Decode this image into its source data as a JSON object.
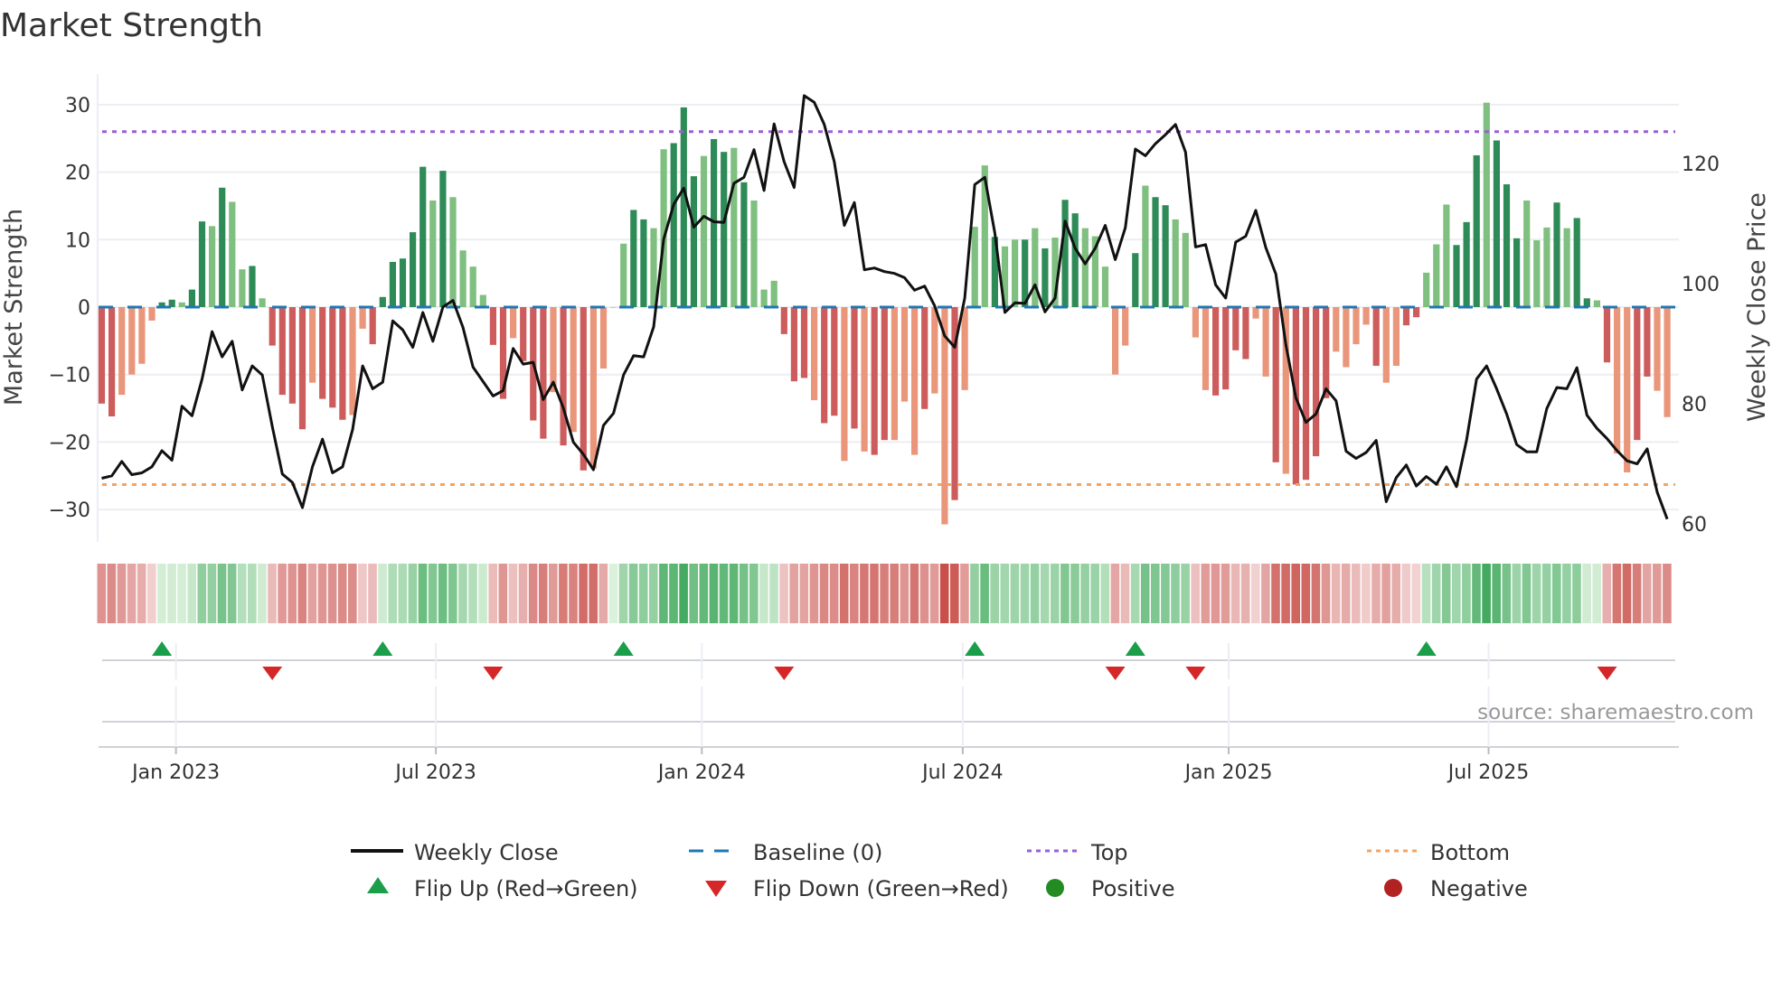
{
  "chart_data": {
    "type": "bar",
    "title": "Market Strength",
    "ylabel": "Market Strength",
    "y2label": "Weekly Close Price",
    "ylim": [
      -35,
      35
    ],
    "y2lim": [
      58,
      136
    ],
    "yticks": [
      "30",
      "20",
      "10",
      "0",
      "−10",
      "−20",
      "−30"
    ],
    "ytick_values": [
      30,
      20,
      10,
      0,
      -10,
      -20,
      -30
    ],
    "y2ticks": [
      "120",
      "100",
      "80",
      "60"
    ],
    "y2tick_values": [
      120,
      100,
      80,
      60
    ],
    "xticks": [
      {
        "label": "Jan 2023",
        "week": 8.4
      },
      {
        "label": "Jul 2023",
        "week": 34.3
      },
      {
        "label": "Jan 2024",
        "week": 60.8
      },
      {
        "label": "Jul 2024",
        "week": 86.8
      },
      {
        "label": "Jan 2025",
        "week": 113.3
      },
      {
        "label": "Jul 2025",
        "week": 139.2
      }
    ],
    "top_level": 26,
    "bottom_level": -26.3,
    "baseline": 0,
    "strength": [
      -14.3,
      -16.2,
      -13,
      -10,
      -8.4,
      -2,
      0.7,
      1.1,
      0.7,
      2.6,
      12.7,
      12,
      17.7,
      15.6,
      5.6,
      6.1,
      1.3,
      -5.7,
      -13,
      -14.3,
      -18.1,
      -11.2,
      -13.6,
      -14.9,
      -16.7,
      -16,
      -3.2,
      -5.5,
      1.5,
      6.7,
      7.2,
      11.1,
      20.8,
      15.8,
      20.2,
      16.3,
      8.4,
      6,
      1.8,
      -5.6,
      -13.6,
      -4.6,
      -8,
      -16.8,
      -19.5,
      -12.6,
      -20.5,
      -18.5,
      -24.2,
      -23.9,
      -9.1,
      0,
      9.4,
      14.4,
      13,
      11.7,
      23.4,
      24.3,
      29.6,
      19.4,
      22.4,
      24.9,
      23,
      23.6,
      18.5,
      15.8,
      2.6,
      3.9,
      -4,
      -11,
      -10.5,
      -13.8,
      -17.2,
      -16.1,
      -22.8,
      -18,
      -21.4,
      -21.9,
      -19.7,
      -19.7,
      -14,
      -21.9,
      -15.1,
      -12.8,
      -32.2,
      -28.6,
      -12.3,
      11.9,
      21,
      10.4,
      9,
      10,
      10,
      11.7,
      8.7,
      10.3,
      15.9,
      13.9,
      11.7,
      10.5,
      6,
      -10,
      -5.7,
      8,
      18,
      16.3,
      15.1,
      13,
      11,
      -4.5,
      -12.3,
      -13.1,
      -12.2,
      -6.4,
      -7.7,
      -1.7,
      -10.3,
      -23,
      -24.7,
      -26.3,
      -25.6,
      -22.1,
      -13.5,
      -6.6,
      -8.9,
      -5.5,
      -2.6,
      -8.7,
      -11.2,
      -8.7,
      -2.7,
      -1.5,
      5.1,
      9.3,
      15.2,
      9.2,
      12.6,
      22.5,
      30.3,
      24.7,
      18.2,
      10.2,
      15.8,
      9.9,
      11.8,
      15.5,
      11.7,
      13.2,
      1.3,
      1,
      -8.2,
      -21.7,
      -24.5,
      -19.7,
      -10.3,
      -12.4,
      -16.3
    ],
    "shade": "ddllllddlddldlldlddddldddllddddddldllllddldddldldllllddlldddlddldlllddd lddldlddllldlldllldlldldlddllllldlddllllddddlldlddddlllldllddllldddldddllldlddldllddllldd",
    "weekly_close": [
      67.6,
      68,
      70.4,
      68.2,
      68.5,
      69.5,
      72.2,
      70.6,
      79.6,
      78,
      84.1,
      92,
      87.8,
      90.4,
      82.3,
      86.3,
      84.8,
      76.2,
      68.3,
      66.9,
      62.7,
      69.5,
      74.1,
      68.5,
      69.5,
      75.7,
      86.3,
      82.5,
      83.6,
      93.8,
      92.3,
      89.4,
      95.2,
      90.4,
      96.1,
      97.2,
      92.7,
      86.1,
      83.7,
      81.3,
      82.2,
      89.2,
      86.6,
      86.9,
      80.7,
      83.6,
      79.3,
      73.6,
      71.6,
      69,
      76.4,
      78.4,
      84.8,
      88,
      87.8,
      92.8,
      107.4,
      113.2,
      115.9,
      109.4,
      111.2,
      110.3,
      110.2,
      116.7,
      117.7,
      122.3,
      115.5,
      126.6,
      120.3,
      116,
      131.3,
      130.2,
      126.5,
      120.3,
      109.7,
      113.5,
      102.3,
      102.6,
      102,
      101.7,
      101,
      98.9,
      99.6,
      96.3,
      91.3,
      89.4,
      97.6,
      116.5,
      117.7,
      108.4,
      95.2,
      96.8,
      96.7,
      99.8,
      95.3,
      97.6,
      110.4,
      105.9,
      103.3,
      105.9,
      109.7,
      104,
      109.3,
      122.4,
      121.3,
      123.3,
      124.8,
      126.5,
      121.9,
      106.1,
      106.5,
      99.8,
      97.6,
      106.9,
      107.9,
      112.2,
      106,
      101.6,
      89.8,
      81,
      76.9,
      78.3,
      82.5,
      80.5,
      72.1,
      70.9,
      71.9,
      73.9,
      63.7,
      67.7,
      69.8,
      66.3,
      67.9,
      66.6,
      69.5,
      66.2,
      73.9,
      84.1,
      86.3,
      82.5,
      78.3,
      73.2,
      72,
      72,
      79.2,
      82.7,
      82.5,
      86,
      78.1,
      75.9,
      74.2,
      72.2,
      70.5,
      70,
      72.5,
      65.3,
      60.8
    ],
    "flip_up_weeks": [
      7,
      29,
      53,
      88,
      104,
      133
    ],
    "flip_down_weeks": [
      18,
      40,
      69,
      102,
      110,
      151
    ],
    "legend": {
      "weekly_close": "Weekly Close",
      "baseline": "Baseline (0)",
      "top": "Top",
      "bottom": "Bottom",
      "flip_up": "Flip Up (Red→Green)",
      "flip_down": "Flip Down (Green→Red)",
      "positive": "Positive",
      "negative": "Negative"
    },
    "legend_placement": "bottom",
    "source": "source: sharemaestro.com",
    "colors": {
      "pos_dark": "#2e8b57",
      "pos_light": "#7fbf7f",
      "neg_dark": "#cd5c5c",
      "neg_light": "#e9967a",
      "line": "#111111",
      "baseline": "#1f77b4",
      "top": "#9b5fd6",
      "bottom": "#f4a460",
      "flip_up": "#1a9e4a",
      "flip_down": "#d62728",
      "positive": "#228b22",
      "negative": "#b22222"
    }
  }
}
